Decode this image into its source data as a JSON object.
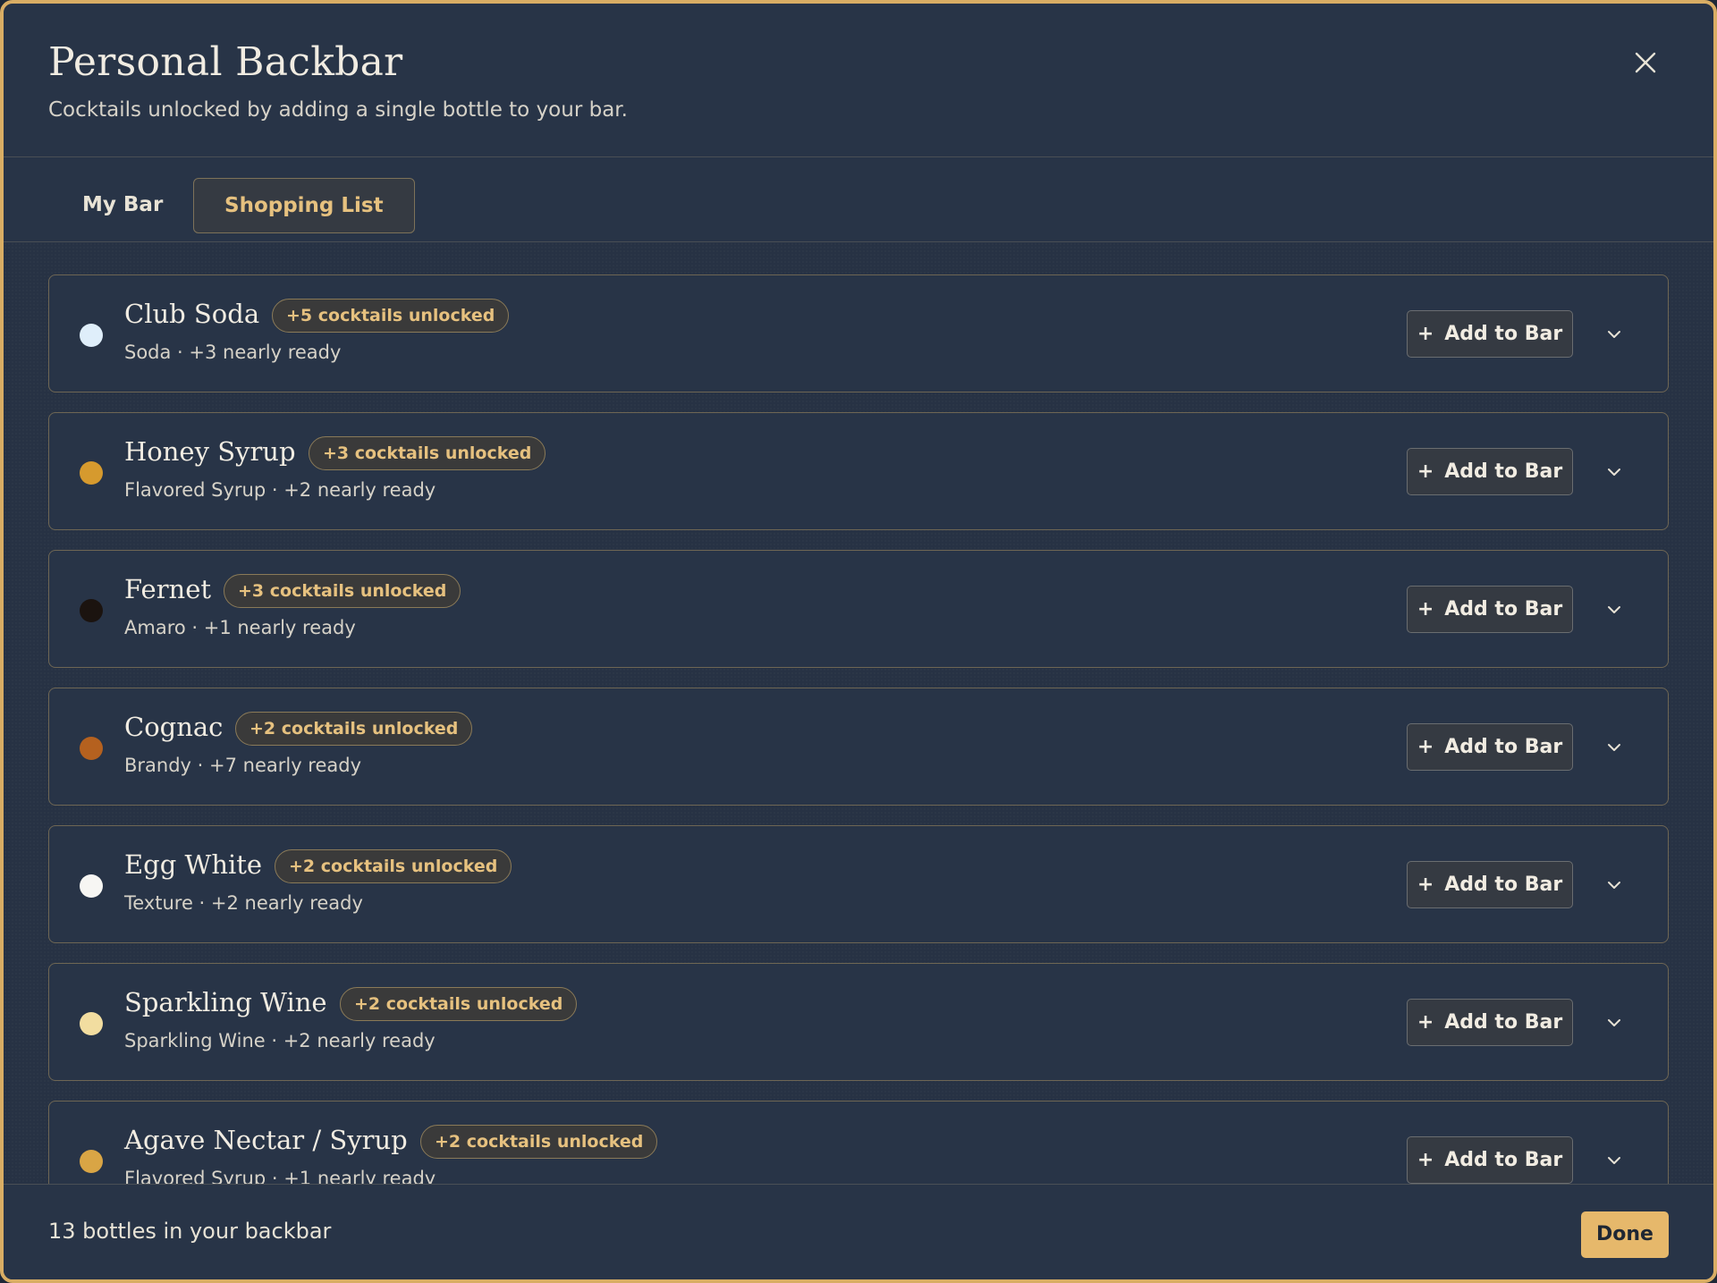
{
  "dialog": {
    "title": "Personal Backbar",
    "subtitle": "Cocktails unlocked by adding a single bottle to your bar.",
    "close_icon": "close-icon"
  },
  "tabs": [
    {
      "label": "My Bar",
      "active": false
    },
    {
      "label": "Shopping List",
      "active": true
    }
  ],
  "items": [
    {
      "name": "Club Soda",
      "badge": "+5 cocktails unlocked",
      "meta": "Soda · +3 nearly ready",
      "color": "#dfeefa",
      "button": "Add to Bar"
    },
    {
      "name": "Honey Syrup",
      "badge": "+3 cocktails unlocked",
      "meta": "Flavored Syrup · +2 nearly ready",
      "color": "#d69a2e",
      "button": "Add to Bar"
    },
    {
      "name": "Fernet",
      "badge": "+3 cocktails unlocked",
      "meta": "Amaro · +1 nearly ready",
      "color": "#1b130f",
      "button": "Add to Bar"
    },
    {
      "name": "Cognac",
      "badge": "+2 cocktails unlocked",
      "meta": "Brandy · +7 nearly ready",
      "color": "#b5611f",
      "button": "Add to Bar"
    },
    {
      "name": "Egg White",
      "badge": "+2 cocktails unlocked",
      "meta": "Texture · +2 nearly ready",
      "color": "#f7f6f3",
      "button": "Add to Bar"
    },
    {
      "name": "Sparkling Wine",
      "badge": "+2 cocktails unlocked",
      "meta": "Sparkling Wine · +2 nearly ready",
      "color": "#f2dda0",
      "button": "Add to Bar"
    },
    {
      "name": "Agave Nectar / Syrup",
      "badge": "+2 cocktails unlocked",
      "meta": "Flavored Syrup · +1 nearly ready",
      "color": "#d9a545",
      "button": "Add to Bar"
    }
  ],
  "footer": {
    "count_text": "13 bottles in your backbar",
    "done_label": "Done"
  },
  "colors": {
    "accent": "#e6b86b",
    "background": "#283447",
    "badge_text": "#e6c17f"
  }
}
